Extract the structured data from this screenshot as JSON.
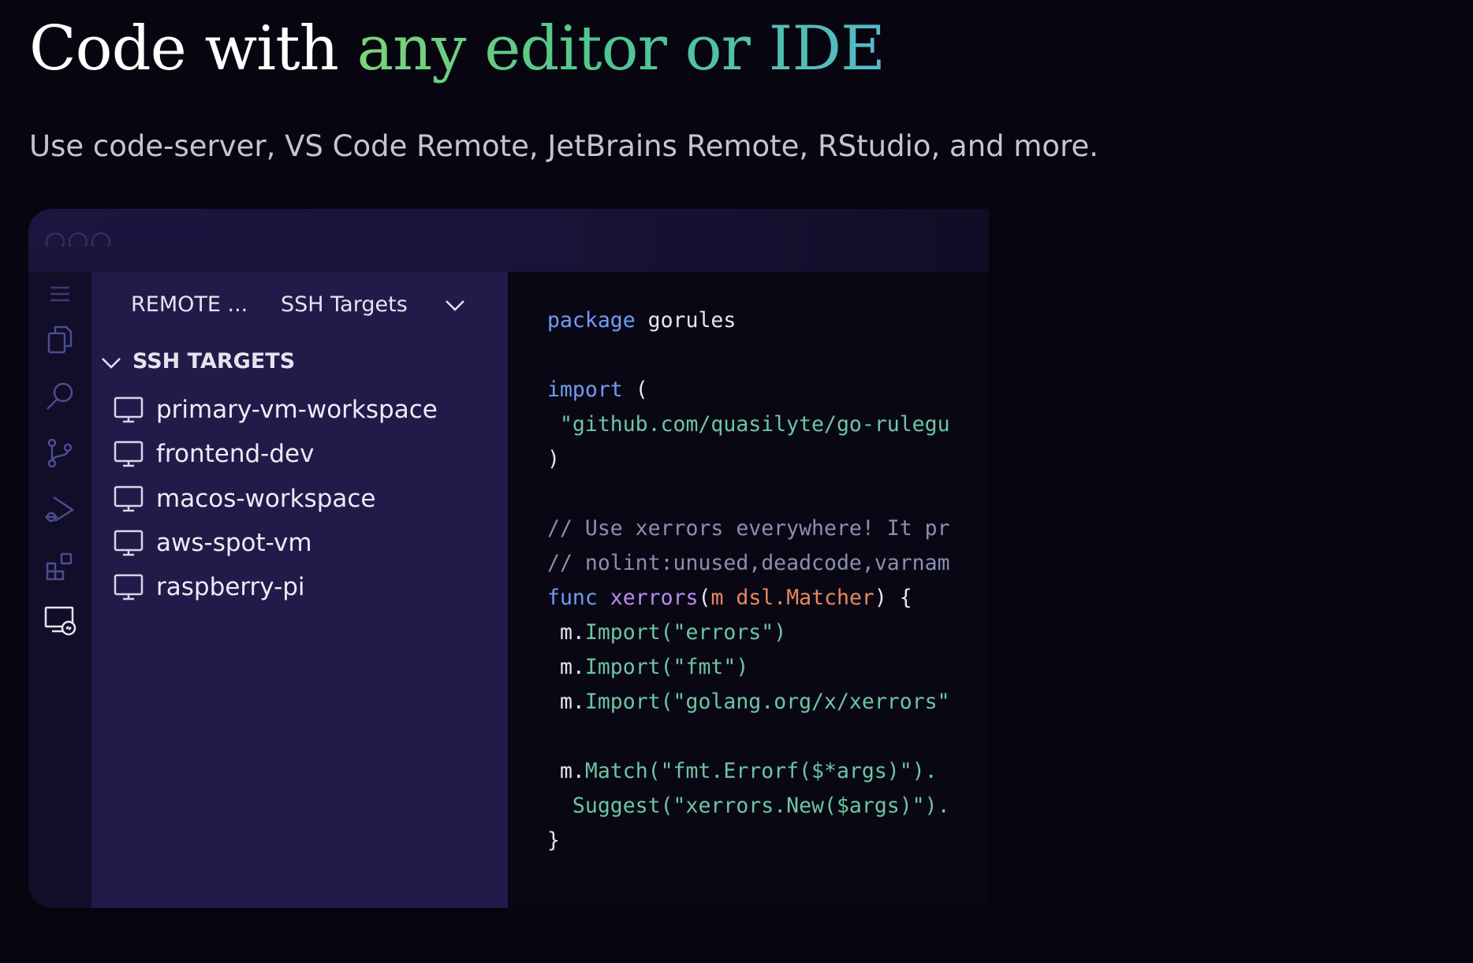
{
  "headline": {
    "plain": "Code with ",
    "highlight": "any editor or IDE"
  },
  "subtitle": "Use code-server, VS Code Remote, JetBrains Remote, RStudio, and more.",
  "colors": {
    "background": "#07050f",
    "gradient_start": "#7fd27a",
    "gradient_end": "#55b9c7",
    "sidebar": "#241a4a",
    "keyword": "#6f9df0",
    "string": "#6cc6a0"
  },
  "activity_bar": {
    "icons": [
      "menu-icon",
      "files-icon",
      "search-icon",
      "source-control-icon",
      "run-debug-icon",
      "extensions-icon",
      "remote-explorer-icon"
    ]
  },
  "sidebar": {
    "header": "REMOTE ...",
    "selector": "SSH Targets",
    "section_title": "SSH TARGETS",
    "targets": [
      "primary-vm-workspace",
      "frontend-dev",
      "macos-workspace",
      "aws-spot-vm",
      "raspberry-pi"
    ]
  },
  "code": {
    "l1_kw": "package",
    "l1_rest": " gorules",
    "l3_kw": "import",
    "l3_rest": " (",
    "l4": " \"github.com/quasilyte/go-rulegu",
    "l5": ")",
    "l7": "// Use xerrors everywhere! It pr",
    "l8": "// nolint:unused,deadcode,varnam",
    "l9_kw": "func",
    "l9_fn": "xerrors",
    "l9_p1": "(",
    "l9_param": "m",
    "l9_type": "dsl.Matcher",
    "l9_end": ") {",
    "l10_m": " m.",
    "l10_method": "Import(\"errors\")",
    "l11_m": " m.",
    "l11_method": "Import(\"fmt\")",
    "l12_m": " m.",
    "l12_method": "Import(\"golang.org/x/xerrors\"",
    "l14_m": " m.",
    "l14_method": "Match(\"fmt.Errorf($*args)\").",
    "l15": "  Suggest(\"xerrors.New($args)\").",
    "l16": "}"
  }
}
